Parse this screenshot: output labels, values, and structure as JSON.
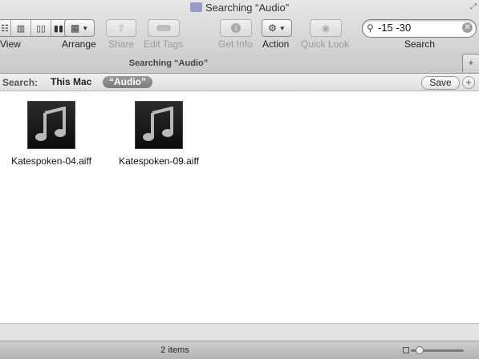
{
  "window": {
    "title": "Searching “Audio”"
  },
  "toolbar": {
    "view_label": "View",
    "arrange_label": "Arrange",
    "share_label": "Share",
    "edit_tags_label": "Edit Tags",
    "get_info_label": "Get Info",
    "action_label": "Action",
    "quick_look_label": "Quick Look",
    "search_label": "Search"
  },
  "search": {
    "value": "-15 -30"
  },
  "tab": {
    "title": "Searching “Audio”"
  },
  "scope": {
    "label": "Search:",
    "this_mac": "This Mac",
    "audio": "“Audio”",
    "save": "Save"
  },
  "files": [
    {
      "name": "Katespoken-04.aiff",
      "icon": "music-note-icon"
    },
    {
      "name": "Katespoken-09.aiff",
      "icon": "music-note-icon"
    }
  ],
  "status": {
    "item_count": "2 items"
  },
  "colors": {
    "scope_selected": "#8a8a8a",
    "icon_bg": "#111111"
  }
}
